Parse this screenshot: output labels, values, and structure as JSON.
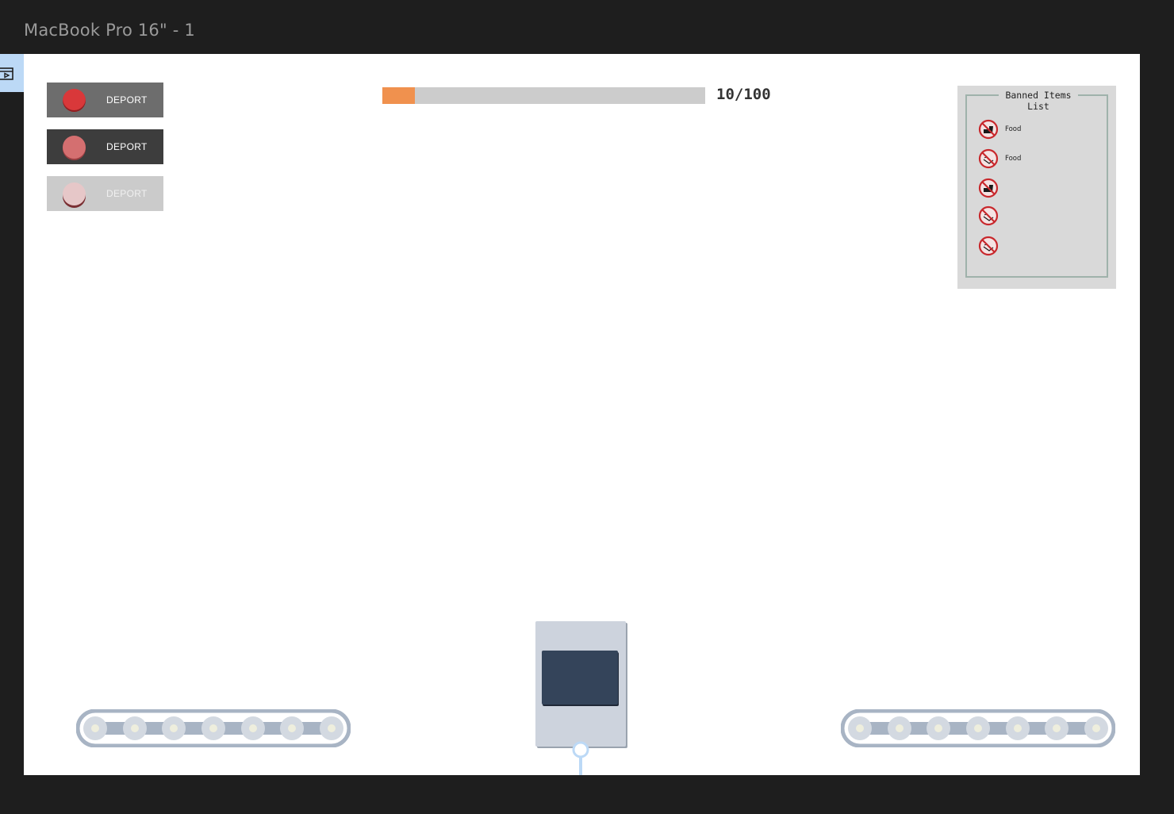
{
  "window": {
    "title": "MacBook Pro 16\" - 1"
  },
  "deport_buttons": [
    {
      "label": "DEPORT",
      "state": "default"
    },
    {
      "label": "DEPORT",
      "state": "pressed"
    },
    {
      "label": "DEPORT",
      "state": "disabled"
    }
  ],
  "progress": {
    "value": 10,
    "max": 100,
    "text": "10/100",
    "fill_color": "#f0914e"
  },
  "banned_list": {
    "title": "Banned Items List",
    "items": [
      {
        "icon": "no-food-icon",
        "label": "Food"
      },
      {
        "icon": "no-smoking-icon",
        "label": "Food"
      },
      {
        "icon": "no-food-icon",
        "label": ""
      },
      {
        "icon": "no-smoking-icon",
        "label": ""
      },
      {
        "icon": "no-smoking-icon",
        "label": ""
      }
    ]
  },
  "colors": {
    "background": "#1e1e1e",
    "canvas": "#ffffff",
    "conveyor": "#a8b4c4",
    "cabinet": "#cdd3dd",
    "screen": "#34445a",
    "figure": "#bcd9f6"
  }
}
